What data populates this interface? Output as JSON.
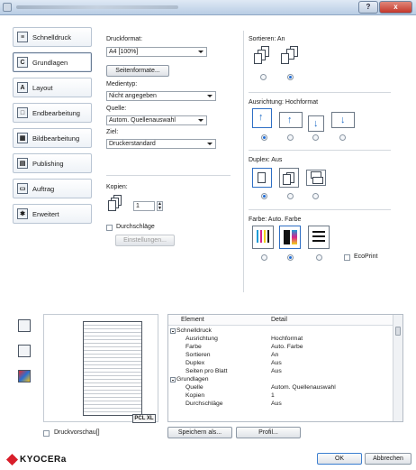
{
  "window": {
    "help_label": "?",
    "close_label": "x"
  },
  "sidebar": {
    "items": [
      {
        "label": "Schnelldruck",
        "icon": "quick-print-icon",
        "glyph": "≡"
      },
      {
        "label": "Grundlagen",
        "icon": "basic-icon",
        "glyph": "C"
      },
      {
        "label": "Layout",
        "icon": "layout-icon",
        "glyph": "A"
      },
      {
        "label": "Endbearbeitung",
        "icon": "finishing-icon",
        "glyph": "□"
      },
      {
        "label": "Bildbearbeitung",
        "icon": "imaging-icon",
        "glyph": "▦"
      },
      {
        "label": "Publishing",
        "icon": "publishing-icon",
        "glyph": "▤"
      },
      {
        "label": "Auftrag",
        "icon": "job-icon",
        "glyph": "▭"
      },
      {
        "label": "Erweitert",
        "icon": "advanced-icon",
        "glyph": "✱"
      }
    ]
  },
  "main": {
    "druckformat_label": "Druckformat:",
    "druckformat_value": "A4 [100%]",
    "seitenformate_button": "Seitenformate...",
    "medientyp_label": "Medientyp:",
    "medientyp_value": "Nicht angegeben",
    "quelle_label": "Quelle:",
    "quelle_value": "Autom. Quellenauswahl",
    "ziel_label": "Ziel:",
    "ziel_value": "Druckerstandard",
    "kopien_label": "Kopien:",
    "kopien_value": "1",
    "durchschlaege_label": "Durchschläge",
    "einstellungen_button": "Einstellungen...",
    "sortieren_label": "Sortieren: An",
    "ausrichtung_label": "Ausrichtung: Hochformat",
    "duplex_label": "Duplex: Aus",
    "farbe_label": "Farbe: Auto. Farbe",
    "ecoprint_label": "EcoPrint"
  },
  "preview": {
    "badge": "PCL XL",
    "checkbox_label": "Druckvorschau[]"
  },
  "table": {
    "col_element": "Element",
    "col_detail": "Detail",
    "rows": [
      {
        "element": "Schnelldruck",
        "detail": "",
        "group": true
      },
      {
        "element": "Ausrichtung",
        "detail": "Hochformat",
        "group": false
      },
      {
        "element": "Farbe",
        "detail": "Auto. Farbe",
        "group": false
      },
      {
        "element": "Sortieren",
        "detail": "An",
        "group": false
      },
      {
        "element": "Duplex",
        "detail": "Aus",
        "group": false
      },
      {
        "element": "Seiten pro Blatt",
        "detail": "Aus",
        "group": false
      },
      {
        "element": "Grundlagen",
        "detail": "",
        "group": true
      },
      {
        "element": "Quelle",
        "detail": "Autom. Quellenauswahl",
        "group": false
      },
      {
        "element": "Kopien",
        "detail": "1",
        "group": false
      },
      {
        "element": "Durchschläge",
        "detail": "Aus",
        "group": false
      }
    ]
  },
  "buttons": {
    "speichern": "Speichern als...",
    "profil": "Profil...",
    "ok": "OK",
    "abbrechen": "Abbrechen"
  },
  "brand": {
    "name": "KYOCERa"
  },
  "colors": {
    "accent": "#1f6cc7",
    "brand_red": "#d81e2a"
  }
}
